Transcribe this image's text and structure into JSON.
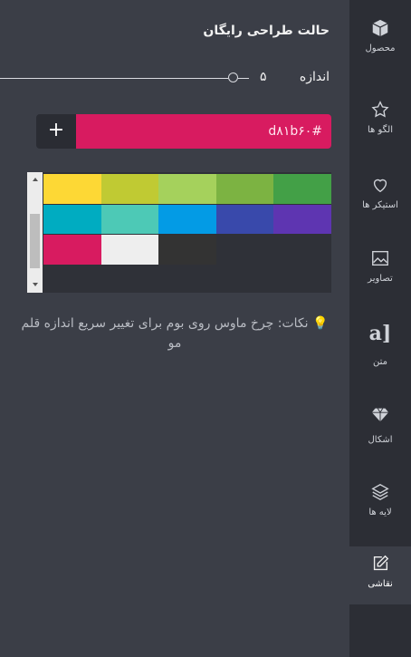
{
  "panel": {
    "title": "حالت طراحی رایگان",
    "size_label": "اندازه",
    "size_value": "۵",
    "size_level": 5,
    "add_button": "+",
    "color_value": "#d81b60",
    "color_display": "d۸۱b۶۰#",
    "palette": [
      "#fdd835",
      "#c0ca33",
      "#a5d15c",
      "#7cb342",
      "#43a047",
      "#00acc1",
      "#4dc9b6",
      "#039be5",
      "#3949ab",
      "#5e35b1",
      "#d81b60",
      "#eeeeee",
      "#333333"
    ],
    "tip_icon": "lightbulb-icon",
    "tip_text": "نکات: چرخ ماوس روی بوم برای تغییر سریع اندازه قلم مو"
  },
  "sidebar": {
    "items": [
      {
        "label": "محصول",
        "icon": "cube-icon"
      },
      {
        "label": "الگو ها",
        "icon": "star-icon"
      },
      {
        "label": "استیکر ها",
        "icon": "heart-icon"
      },
      {
        "label": "تصاویر",
        "icon": "image-icon"
      },
      {
        "label": "متن",
        "icon": "text-icon"
      },
      {
        "label": "اشکال",
        "icon": "diamond-icon"
      },
      {
        "label": "لایه ها",
        "icon": "layers-icon"
      },
      {
        "label": "نقاشی",
        "icon": "pencil-icon"
      }
    ],
    "active": "نقاشی",
    "text_glyph": "a]"
  }
}
